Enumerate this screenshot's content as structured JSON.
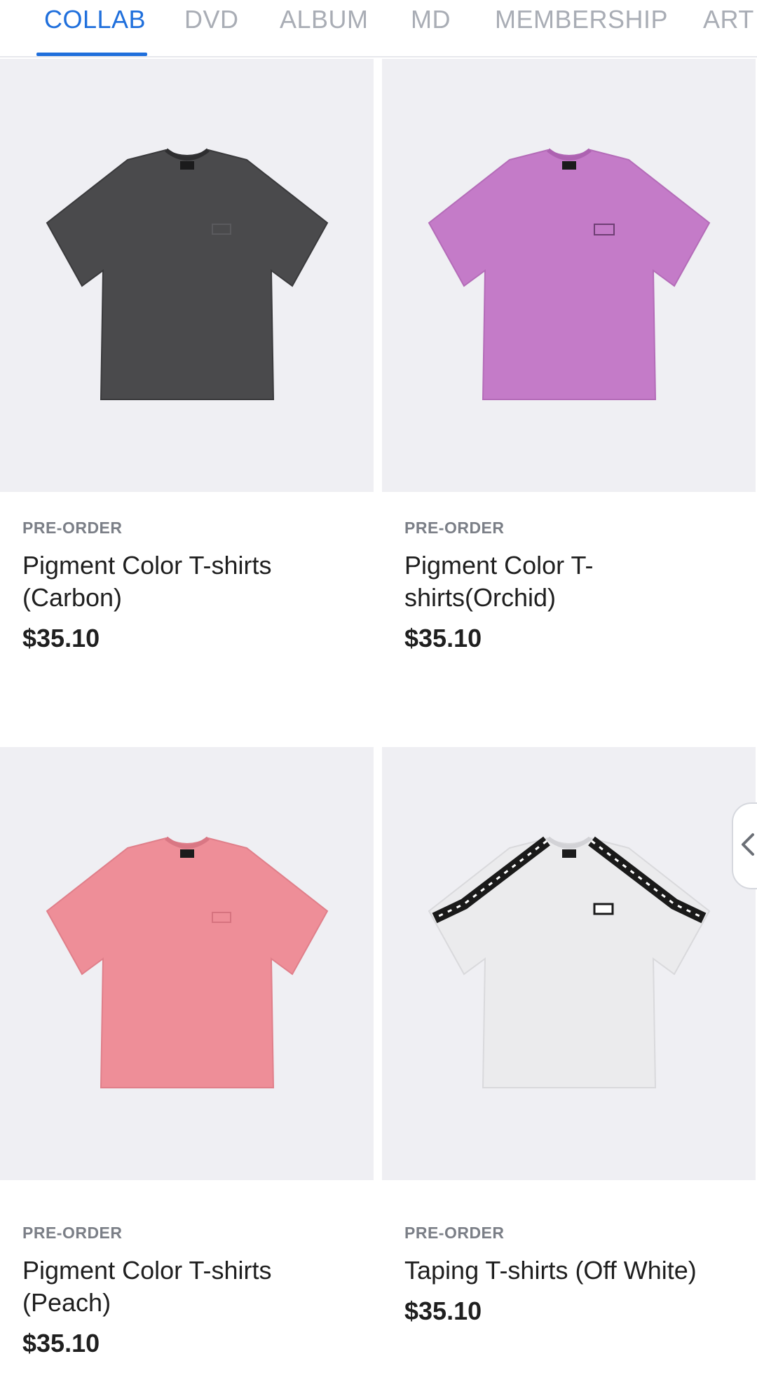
{
  "tabs": [
    {
      "label": "COLLAB",
      "active": true
    },
    {
      "label": "DVD",
      "active": false
    },
    {
      "label": "ALBUM",
      "active": false
    },
    {
      "label": "MD",
      "active": false
    },
    {
      "label": "MEMBERSHIP",
      "active": false
    },
    {
      "label": "ART",
      "active": false
    }
  ],
  "products": [
    {
      "tag": "PRE-ORDER",
      "title": "Pigment Color T-shirts (Carbon)",
      "price": "$35.10",
      "color": "#4a4a4c"
    },
    {
      "tag": "PRE-ORDER",
      "title": "Pigment Color T-shirts(Orchid)",
      "price": "$35.10",
      "color": "#c47bc8"
    },
    {
      "tag": "PRE-ORDER",
      "title": "Pigment Color T-shirts (Peach)",
      "price": "$35.10",
      "color": "#ee8e98"
    },
    {
      "tag": "PRE-ORDER",
      "title": "Taping T-shirts (Off White)",
      "price": "$35.10",
      "color": "#ebebed"
    }
  ],
  "icons": {
    "side_handle": "chevron-left-icon",
    "logo": "fh-logo-icon"
  },
  "colors": {
    "accent": "#1f6fdc",
    "tab_inactive": "#a9adb5",
    "card_bg": "#efeff3"
  }
}
